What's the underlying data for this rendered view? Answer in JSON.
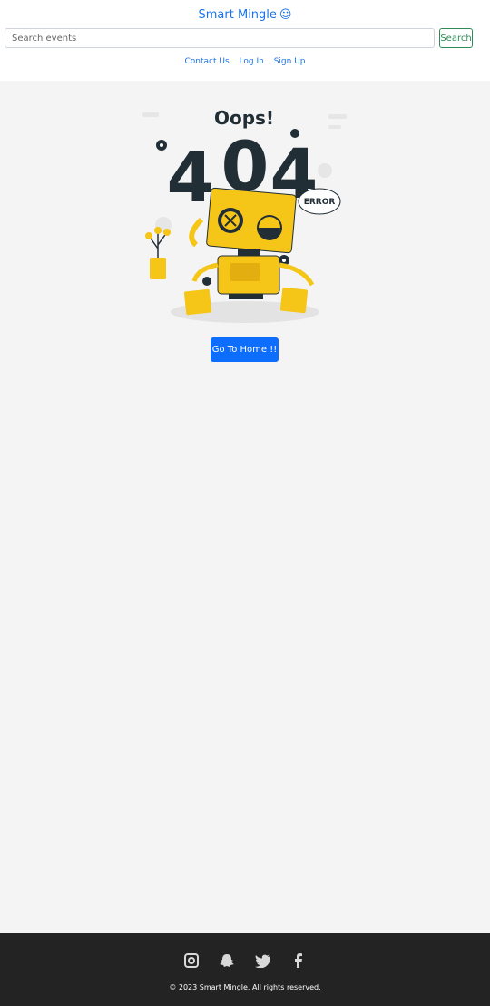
{
  "header": {
    "brand": "Smart Mingle",
    "brand_icon": "smile-icon",
    "search_placeholder": "Search events",
    "search_label": "Search"
  },
  "nav": {
    "items": [
      {
        "label": "Contact Us"
      },
      {
        "label": "Log In"
      },
      {
        "label": "Sign Up"
      }
    ]
  },
  "error": {
    "heading": "Oops!",
    "code_a": "4",
    "code_b": "0",
    "code_c": "4",
    "badge": "ERROR",
    "button_label": "Go To Home !!"
  },
  "footer": {
    "socials": [
      "instagram-icon",
      "snapchat-icon",
      "twitter-icon",
      "facebook-icon"
    ],
    "copyright": "© 2023 Smart Mingle. All rights reserved."
  },
  "colors": {
    "brand": "#1a73e8",
    "button": "#0d6efd",
    "robot": "#f5c518",
    "footer": "#232323"
  }
}
